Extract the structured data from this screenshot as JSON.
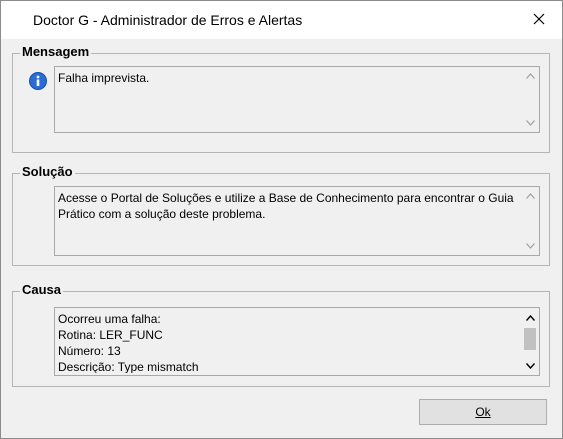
{
  "window": {
    "title": "Doctor G - Administrador de Erros e Alertas",
    "close_symbol": "✕"
  },
  "mensagem": {
    "label": "Mensagem",
    "icon": "info-icon",
    "text": "Falha imprevista."
  },
  "solucao": {
    "label": "Solução",
    "text": "Acesse o Portal de Soluções e utilize a Base de Conhecimento para encontrar o Guia Prático com a solução deste problema."
  },
  "causa": {
    "label": "Causa",
    "lines": [
      "Ocorreu uma falha:",
      "Rotina: LER_FUNC",
      "Número: 13",
      "Descrição: Type mismatch"
    ]
  },
  "buttons": {
    "ok_label": "Ok"
  },
  "colors": {
    "info_blue": "#2b6cd6",
    "scroll_thumb": "#c1c1c1"
  }
}
